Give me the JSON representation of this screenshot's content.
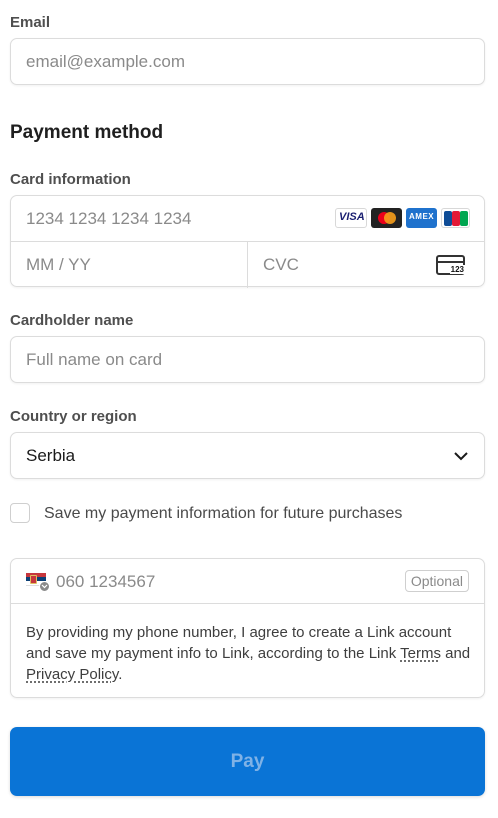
{
  "email": {
    "label": "Email",
    "placeholder": "email@example.com"
  },
  "payment": {
    "heading": "Payment method",
    "card_label": "Card information",
    "card_number_placeholder": "1234 1234 1234 1234",
    "expiry_placeholder": "MM / YY",
    "cvc_placeholder": "CVC",
    "cvc_icon_text": "123",
    "brands": [
      "VISA",
      "mastercard",
      "AMEX",
      "JCB"
    ]
  },
  "cardholder": {
    "label": "Cardholder name",
    "placeholder": "Full name on card"
  },
  "country": {
    "label": "Country or region",
    "selected": "Serbia"
  },
  "save_info": {
    "label": "Save my payment information for future purchases",
    "checked": false
  },
  "link": {
    "phone_placeholder": "060 1234567",
    "optional_badge": "Optional",
    "legal_pre": "By providing my phone number, I agree to create a Link account and save my payment info to Link, according to the Link ",
    "terms": "Terms",
    "and": " and ",
    "privacy": "Privacy Policy",
    "period": "."
  },
  "pay_button": {
    "label": "Pay"
  },
  "colors": {
    "accent": "#0a74d6",
    "border": "#dcdcdc"
  },
  "icons": [
    "serbia-flag-icon",
    "chevron-down-icon",
    "cvc-card-icon"
  ]
}
